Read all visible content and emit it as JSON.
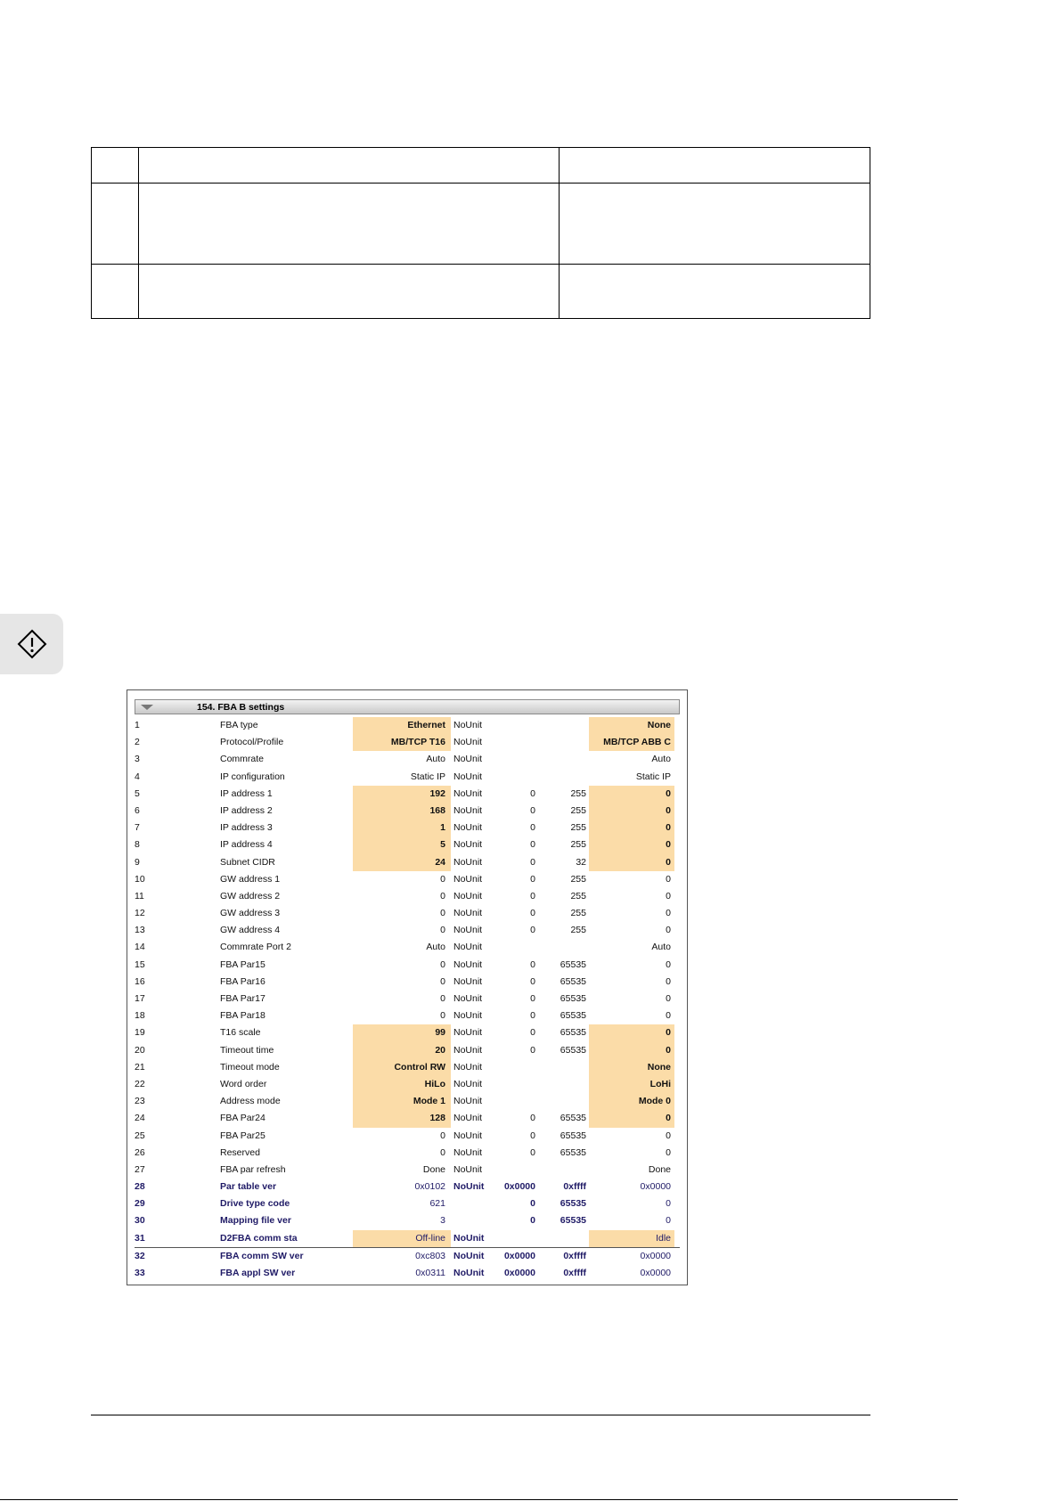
{
  "group": {
    "title": "154. FBA B settings",
    "rows": [
      {
        "idx": "1",
        "name": "FBA type",
        "value": "Ethernet",
        "unit": "NoUnit",
        "min": "",
        "max": "",
        "def": "None",
        "hl": true,
        "ro": false
      },
      {
        "idx": "2",
        "name": "Protocol/Profile",
        "value": "MB/TCP T16",
        "unit": "NoUnit",
        "min": "",
        "max": "",
        "def": "MB/TCP ABB C",
        "hl": true,
        "ro": false
      },
      {
        "idx": "3",
        "name": "Commrate",
        "value": "Auto",
        "unit": "NoUnit",
        "min": "",
        "max": "",
        "def": "Auto",
        "hl": false,
        "ro": false
      },
      {
        "idx": "4",
        "name": "IP configuration",
        "value": "Static IP",
        "unit": "NoUnit",
        "min": "",
        "max": "",
        "def": "Static IP",
        "hl": false,
        "ro": false
      },
      {
        "idx": "5",
        "name": "IP address 1",
        "value": "192",
        "unit": "NoUnit",
        "min": "0",
        "max": "255",
        "def": "0",
        "hl": true,
        "ro": false
      },
      {
        "idx": "6",
        "name": "IP address 2",
        "value": "168",
        "unit": "NoUnit",
        "min": "0",
        "max": "255",
        "def": "0",
        "hl": true,
        "ro": false
      },
      {
        "idx": "7",
        "name": "IP address 3",
        "value": "1",
        "unit": "NoUnit",
        "min": "0",
        "max": "255",
        "def": "0",
        "hl": true,
        "ro": false
      },
      {
        "idx": "8",
        "name": "IP address 4",
        "value": "5",
        "unit": "NoUnit",
        "min": "0",
        "max": "255",
        "def": "0",
        "hl": true,
        "ro": false
      },
      {
        "idx": "9",
        "name": "Subnet CIDR",
        "value": "24",
        "unit": "NoUnit",
        "min": "0",
        "max": "32",
        "def": "0",
        "hl": true,
        "ro": false
      },
      {
        "idx": "10",
        "name": "GW address 1",
        "value": "0",
        "unit": "NoUnit",
        "min": "0",
        "max": "255",
        "def": "0",
        "hl": false,
        "ro": false
      },
      {
        "idx": "11",
        "name": "GW address 2",
        "value": "0",
        "unit": "NoUnit",
        "min": "0",
        "max": "255",
        "def": "0",
        "hl": false,
        "ro": false
      },
      {
        "idx": "12",
        "name": "GW address 3",
        "value": "0",
        "unit": "NoUnit",
        "min": "0",
        "max": "255",
        "def": "0",
        "hl": false,
        "ro": false
      },
      {
        "idx": "13",
        "name": "GW address 4",
        "value": "0",
        "unit": "NoUnit",
        "min": "0",
        "max": "255",
        "def": "0",
        "hl": false,
        "ro": false
      },
      {
        "idx": "14",
        "name": "Commrate Port 2",
        "value": "Auto",
        "unit": "NoUnit",
        "min": "",
        "max": "",
        "def": "Auto",
        "hl": false,
        "ro": false
      },
      {
        "idx": "15",
        "name": "FBA Par15",
        "value": "0",
        "unit": "NoUnit",
        "min": "0",
        "max": "65535",
        "def": "0",
        "hl": false,
        "ro": false
      },
      {
        "idx": "16",
        "name": "FBA Par16",
        "value": "0",
        "unit": "NoUnit",
        "min": "0",
        "max": "65535",
        "def": "0",
        "hl": false,
        "ro": false
      },
      {
        "idx": "17",
        "name": "FBA Par17",
        "value": "0",
        "unit": "NoUnit",
        "min": "0",
        "max": "65535",
        "def": "0",
        "hl": false,
        "ro": false
      },
      {
        "idx": "18",
        "name": "FBA Par18",
        "value": "0",
        "unit": "NoUnit",
        "min": "0",
        "max": "65535",
        "def": "0",
        "hl": false,
        "ro": false
      },
      {
        "idx": "19",
        "name": "T16 scale",
        "value": "99",
        "unit": "NoUnit",
        "min": "0",
        "max": "65535",
        "def": "0",
        "hl": true,
        "ro": false
      },
      {
        "idx": "20",
        "name": "Timeout time",
        "value": "20",
        "unit": "NoUnit",
        "min": "0",
        "max": "65535",
        "def": "0",
        "hl": true,
        "ro": false
      },
      {
        "idx": "21",
        "name": "Timeout mode",
        "value": "Control RW",
        "unit": "NoUnit",
        "min": "",
        "max": "",
        "def": "None",
        "hl": true,
        "ro": false
      },
      {
        "idx": "22",
        "name": "Word order",
        "value": "HiLo",
        "unit": "NoUnit",
        "min": "",
        "max": "",
        "def": "LoHi",
        "hl": true,
        "ro": false
      },
      {
        "idx": "23",
        "name": "Address mode",
        "value": "Mode 1",
        "unit": "NoUnit",
        "min": "",
        "max": "",
        "def": "Mode 0",
        "hl": true,
        "ro": false
      },
      {
        "idx": "24",
        "name": "FBA Par24",
        "value": "128",
        "unit": "NoUnit",
        "min": "0",
        "max": "65535",
        "def": "0",
        "hl": true,
        "ro": false
      },
      {
        "idx": "25",
        "name": "FBA Par25",
        "value": "0",
        "unit": "NoUnit",
        "min": "0",
        "max": "65535",
        "def": "0",
        "hl": false,
        "ro": false
      },
      {
        "idx": "26",
        "name": "Reserved",
        "value": "0",
        "unit": "NoUnit",
        "min": "0",
        "max": "65535",
        "def": "0",
        "hl": false,
        "ro": false
      },
      {
        "idx": "27",
        "name": "FBA par refresh",
        "value": "Done",
        "unit": "NoUnit",
        "min": "",
        "max": "",
        "def": "Done",
        "hl": false,
        "ro": false
      },
      {
        "idx": "28",
        "name": "Par table ver",
        "value": "0x0102",
        "unit": "NoUnit",
        "min": "0x0000",
        "max": "0xffff",
        "def": "0x0000",
        "hl": false,
        "ro": true
      },
      {
        "idx": "29",
        "name": "Drive type code",
        "value": "621",
        "unit": "",
        "min": "0",
        "max": "65535",
        "def": "0",
        "hl": false,
        "ro": true
      },
      {
        "idx": "30",
        "name": "Mapping file ver",
        "value": "3",
        "unit": "",
        "min": "0",
        "max": "65535",
        "def": "0",
        "hl": false,
        "ro": true
      },
      {
        "idx": "31",
        "name": "D2FBA comm sta",
        "value": "Off-line",
        "unit": "NoUnit",
        "min": "",
        "max": "",
        "def": "Idle",
        "hl": true,
        "ro": true
      },
      {
        "idx": "32",
        "name": "FBA comm SW ver",
        "value": "0xc803",
        "unit": "NoUnit",
        "min": "0x0000",
        "max": "0xffff",
        "def": "0x0000",
        "hl": false,
        "ro": true
      },
      {
        "idx": "33",
        "name": "FBA appl SW ver",
        "value": "0x0311",
        "unit": "NoUnit",
        "min": "0x0000",
        "max": "0xffff",
        "def": "0x0000",
        "hl": false,
        "ro": true
      }
    ]
  },
  "icons": {
    "side_tab": "diamond-info-icon",
    "expand": "triangle-down-icon"
  },
  "colors": {
    "highlight": "#fbdca8",
    "readonly_text": "#1f1a66"
  }
}
